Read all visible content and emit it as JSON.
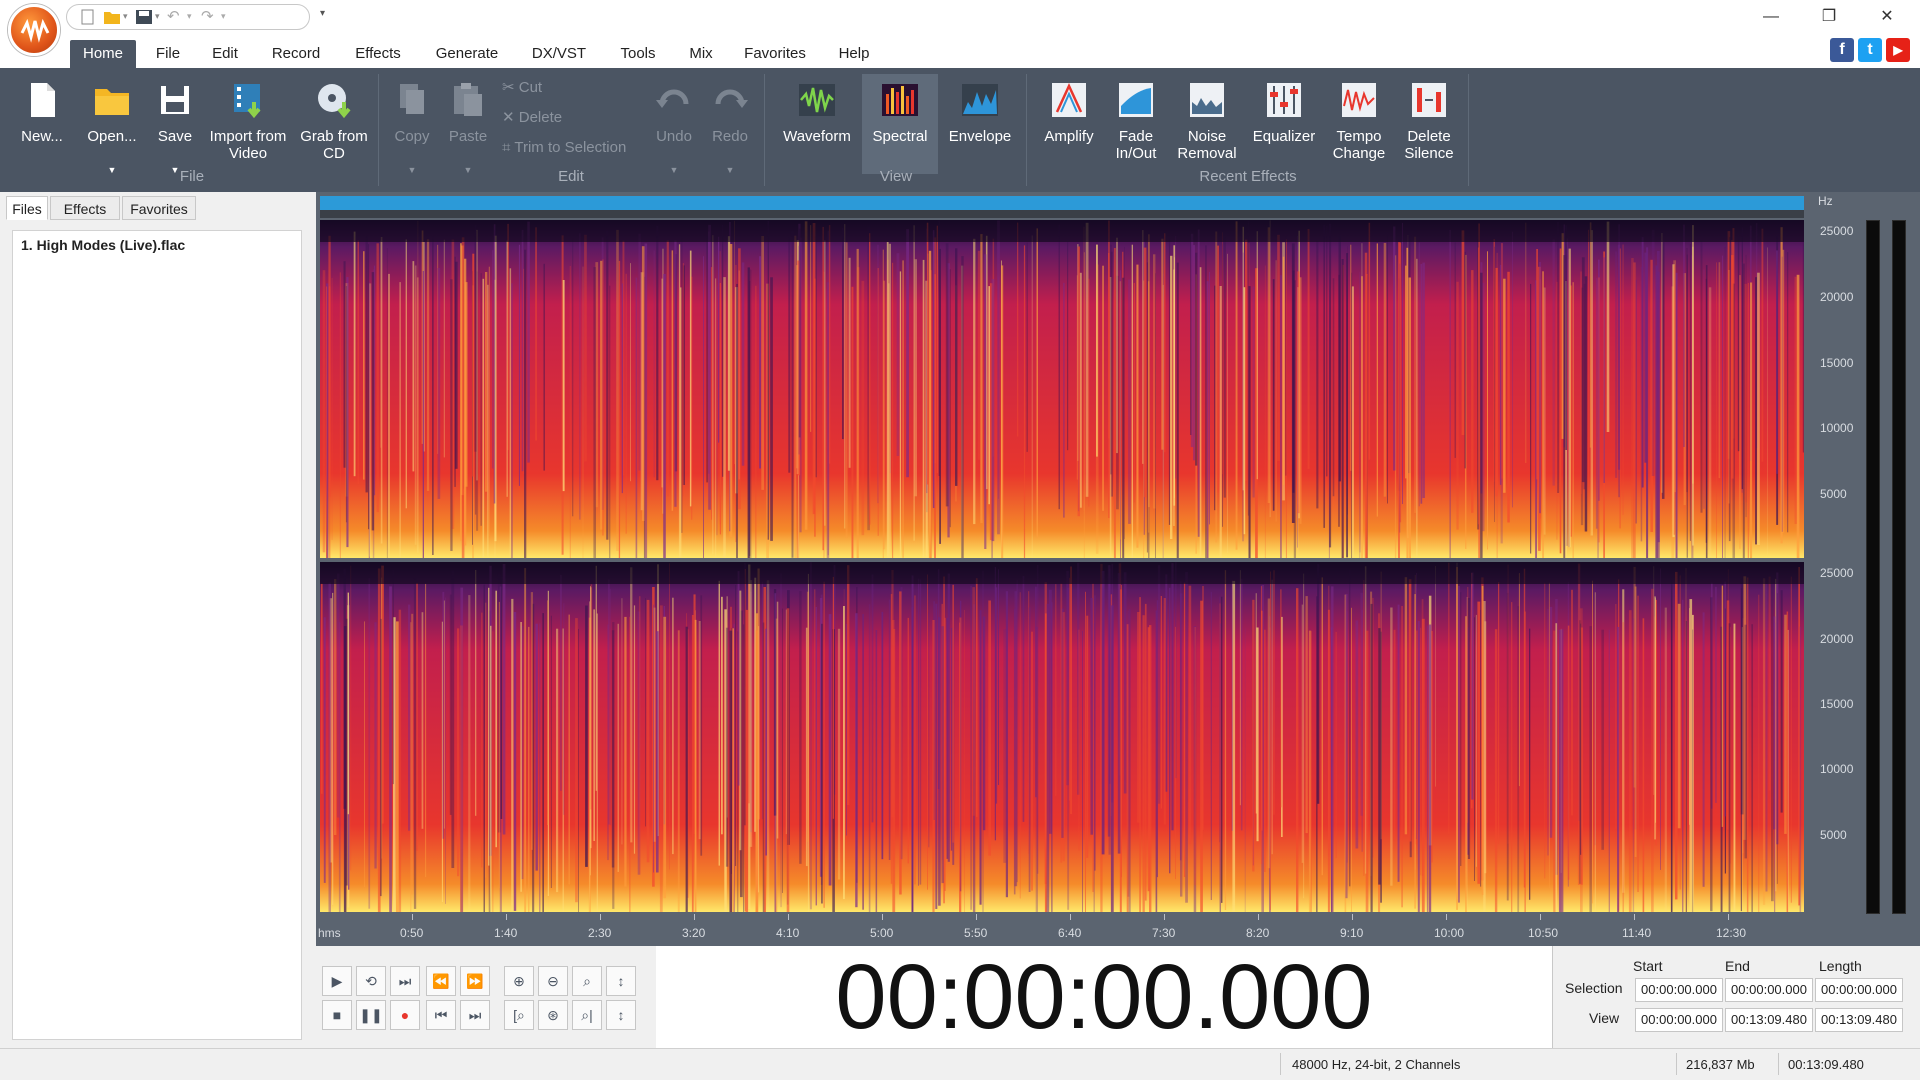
{
  "app": {
    "accent": "#4b5563",
    "brand": "#e0551a"
  },
  "window_controls": {
    "minimize": "—",
    "restore": "❐",
    "close": "✕"
  },
  "ribbon_tabs": [
    "Home",
    "File",
    "Edit",
    "Record",
    "Effects",
    "Generate",
    "DX/VST",
    "Tools",
    "Mix",
    "Favorites",
    "Help"
  ],
  "social": [
    "f",
    "t",
    "▶"
  ],
  "ribbon": {
    "file_group": {
      "label": "File",
      "buttons": [
        {
          "label": "New...",
          "icon": "new-file-icon"
        },
        {
          "label": "Open...",
          "icon": "folder-icon"
        },
        {
          "label": "Save",
          "icon": "save-icon"
        },
        {
          "label": "Import from Video",
          "icon": "film-icon"
        },
        {
          "label": "Grab from CD",
          "icon": "cd-icon"
        }
      ]
    },
    "edit_group": {
      "label": "Edit",
      "copy": "Copy",
      "paste": "Paste",
      "cut": "Cut",
      "delete": "Delete",
      "trim": "Trim to Selection",
      "undo": "Undo",
      "redo": "Redo"
    },
    "view_group": {
      "label": "View",
      "buttons": [
        {
          "label": "Waveform",
          "icon": "waveform-icon"
        },
        {
          "label": "Spectral",
          "icon": "spectral-icon"
        },
        {
          "label": "Envelope",
          "icon": "envelope-icon"
        }
      ]
    },
    "recent_effects_group": {
      "label": "Recent Effects",
      "buttons": [
        {
          "label": "Amplify",
          "icon": "amplify-icon"
        },
        {
          "label": "Fade In/Out",
          "icon": "fade-icon"
        },
        {
          "label": "Noise Removal",
          "icon": "noise-removal-icon"
        },
        {
          "label": "Equalizer",
          "icon": "equalizer-icon"
        },
        {
          "label": "Tempo Change",
          "icon": "tempo-icon"
        },
        {
          "label": "Delete Silence",
          "icon": "delete-silence-icon"
        }
      ]
    }
  },
  "left_panel": {
    "tabs": [
      "Files",
      "Effects",
      "Favorites"
    ],
    "files": [
      "1. High Modes (Live).flac"
    ]
  },
  "spectrogram": {
    "freq_unit": "Hz",
    "freq_ticks": [
      "25000",
      "20000",
      "15000",
      "10000",
      "5000"
    ],
    "time_unit": "hms",
    "time_ticks": [
      "0:50",
      "1:40",
      "2:30",
      "3:20",
      "4:10",
      "5:00",
      "5:50",
      "6:40",
      "7:30",
      "8:20",
      "9:10",
      "10:00",
      "10:50",
      "11:40",
      "12:30"
    ]
  },
  "transport": {
    "time_display": "00:00:00.000"
  },
  "selection_panel": {
    "headers": [
      "Start",
      "End",
      "Length"
    ],
    "rows": [
      {
        "label": "Selection",
        "start": "00:00:00.000",
        "end": "00:00:00.000",
        "length": "00:00:00.000"
      },
      {
        "label": "View",
        "start": "00:00:00.000",
        "end": "00:13:09.480",
        "length": "00:13:09.480"
      }
    ]
  },
  "status": {
    "format": "48000 Hz, 24-bit, 2 Channels",
    "size": "216,837 Mb",
    "duration": "00:13:09.480"
  }
}
